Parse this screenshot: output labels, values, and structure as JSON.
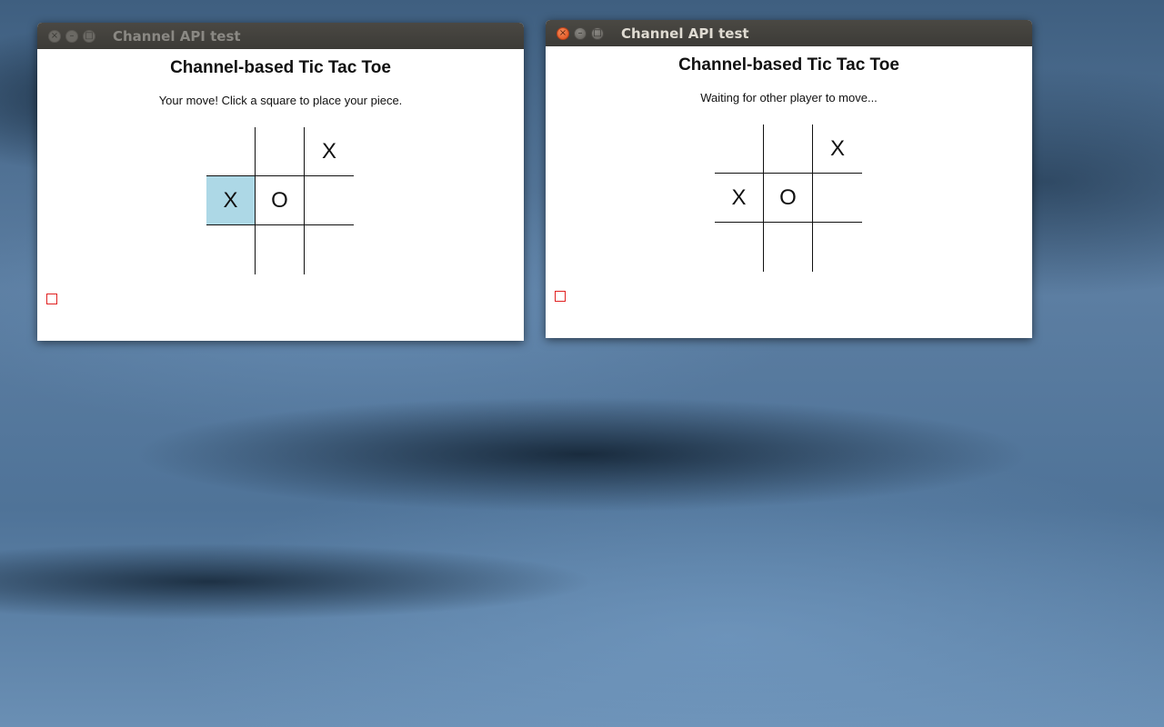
{
  "windows": [
    {
      "title": "Channel API test",
      "state": "inactive",
      "heading": "Channel-based Tic Tac Toe",
      "status": "Your move! Click a square to place your piece.",
      "board": [
        "",
        "",
        "X",
        "X",
        "O",
        "",
        "",
        "",
        ""
      ],
      "highlighted_cell": 3
    },
    {
      "title": "Channel API test",
      "state": "active",
      "heading": "Channel-based Tic Tac Toe",
      "status": "Waiting for other player to move...",
      "board": [
        "",
        "",
        "X",
        "X",
        "O",
        "",
        "",
        "",
        ""
      ],
      "highlighted_cell": null
    }
  ],
  "icons": {
    "close": "×",
    "minimize": "–",
    "maximize": "□"
  },
  "colors": {
    "highlight": "#add8e6",
    "titlebar": "#3c3b37",
    "marker_border": "#e02020"
  }
}
